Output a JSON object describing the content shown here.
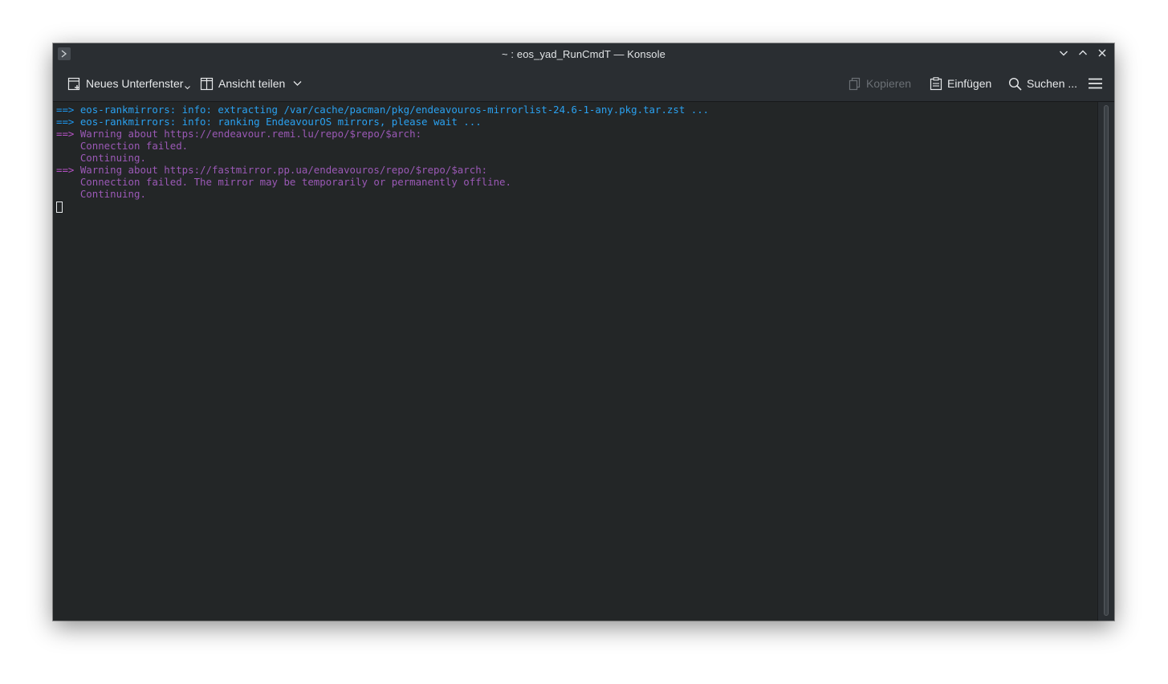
{
  "window": {
    "title": "~ : eos_yad_RunCmdT — Konsole"
  },
  "titlebar_icons": {
    "app": "terminal-prompt-icon",
    "minimize": "chevron-down-icon",
    "maximize": "chevron-up-icon",
    "close": "close-icon"
  },
  "toolbar": {
    "new_tab_label": "Neues Unterfenster",
    "split_view_label": "Ansicht teilen",
    "copy_label": "Kopieren",
    "paste_label": "Einfügen",
    "search_label": "Suchen ...",
    "icons": {
      "new_tab": "new-tab-icon",
      "split_view": "split-view-icon",
      "copy": "copy-icon",
      "paste": "paste-icon",
      "search": "search-icon",
      "menu": "hamburger-menu-icon"
    }
  },
  "terminal": {
    "lines": [
      {
        "prefix": "==> ",
        "text": "eos-rankmirrors: info: extracting /var/cache/pacman/pkg/endeavouros-mirrorlist-24.6-1-any.pkg.tar.zst ..."
      },
      {
        "prefix": "==> ",
        "text": "eos-rankmirrors: info: ranking EndeavourOS mirrors, please wait ..."
      },
      {
        "prefix": "==> ",
        "text": "Warning about https://endeavour.remi.lu/repo/$repo/$arch:"
      },
      {
        "prefix": "    ",
        "text": "Connection failed."
      },
      {
        "prefix": "    ",
        "text": "Continuing."
      },
      {
        "prefix": "==> ",
        "text": "Warning about https://fastmirror.pp.ua/endeavouros/repo/$repo/$arch:"
      },
      {
        "prefix": "    ",
        "text": "Connection failed. The mirror may be temporarily or permanently offline."
      },
      {
        "prefix": "    ",
        "text": "Continuing."
      }
    ]
  },
  "colors": {
    "terminal_bg": "#232627",
    "info_blue": "#2aa1f0",
    "warning_magenta": "#9b59b6",
    "chrome_bg": "#2a2e32"
  }
}
